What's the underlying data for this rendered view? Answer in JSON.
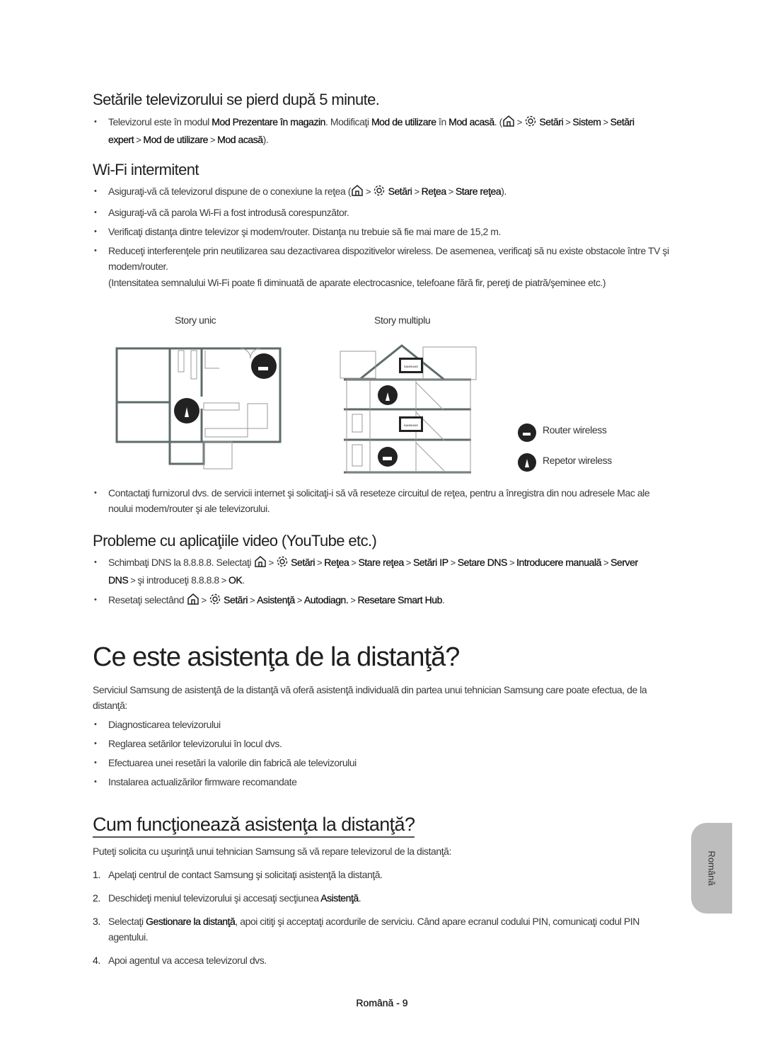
{
  "section1": {
    "title": "Setările televizorului se pierd după 5 minute.",
    "bullets": [
      [
        {
          "t": "Televizorul este în modul "
        },
        {
          "b": "Mod Prezentare în magazin"
        },
        {
          "t": ". Modificaţi "
        },
        {
          "b": "Mod de utilizare"
        },
        {
          "t": " în "
        },
        {
          "b": "Mod acasă"
        },
        {
          "t": ". ("
        },
        {
          "i": "home"
        },
        {
          "s": ">"
        },
        {
          "i": "gear"
        },
        {
          "b": " Setări"
        },
        {
          "s": ">"
        },
        {
          "b": "Sistem"
        },
        {
          "s": ">"
        },
        {
          "b": "Setări expert"
        },
        {
          "s": ">"
        },
        {
          "b": "Mod de utilizare"
        },
        {
          "s": ">"
        },
        {
          "b": "Mod acasă"
        },
        {
          "t": ")."
        }
      ]
    ]
  },
  "section2": {
    "title": "Wi-Fi intermitent",
    "bullets": [
      [
        {
          "t": "Asiguraţi-vă că televizorul dispune de o conexiune la reţea ("
        },
        {
          "i": "home"
        },
        {
          "s": ">"
        },
        {
          "i": "gear"
        },
        {
          "b": " Setări"
        },
        {
          "s": ">"
        },
        {
          "b": "Reţea"
        },
        {
          "s": ">"
        },
        {
          "b": "Stare reţea"
        },
        {
          "t": ")."
        }
      ],
      [
        {
          "t": "Asiguraţi-vă că parola Wi-Fi a fost introdusă corespunzător."
        }
      ],
      [
        {
          "t": "Verificaţi distanţa dintre televizor şi modem/router. Distanţa nu trebuie să fie mai mare de 15,2 m."
        }
      ],
      [
        {
          "t": "Reduceţi interferenţele prin neutilizarea sau dezactivarea dispozitivelor wireless. De asemenea, verificaţi să nu existe obstacole între TV şi modem/router."
        }
      ]
    ],
    "note": "(Intensitatea semnalului Wi-Fi poate fi diminuată de aparate electrocasnice, telefoane fără fir, pereţi de piatră/şeminee etc.)",
    "diagram": {
      "label_single": "Story unic",
      "label_multi": "Story multiplu",
      "legend_router": "Router wireless",
      "legend_repeater": "Repetor wireless",
      "tv_brand": "SAMSUNG"
    },
    "bullets_after": [
      [
        {
          "t": "Contactaţi furnizorul dvs. de servicii internet şi solicitaţi-i să vă reseteze circuitul de reţea, pentru a înregistra din nou adresele Mac ale noului modem/router şi ale televizorului."
        }
      ]
    ]
  },
  "section3": {
    "title": "Probleme cu aplicaţiile video (YouTube etc.)",
    "bullets": [
      [
        {
          "t": "Schimbaţi DNS la 8.8.8.8. Selectaţi "
        },
        {
          "i": "home"
        },
        {
          "s": ">"
        },
        {
          "i": "gear"
        },
        {
          "b": " Setări"
        },
        {
          "s": ">"
        },
        {
          "b": "Reţea"
        },
        {
          "s": ">"
        },
        {
          "b": "Stare reţea"
        },
        {
          "s": ">"
        },
        {
          "b": "Setări IP"
        },
        {
          "s": ">"
        },
        {
          "b": "Setare DNS"
        },
        {
          "s": ">"
        },
        {
          "b": "Introducere manuală"
        },
        {
          "s": ">"
        },
        {
          "b": "Server DNS"
        },
        {
          "s": ">"
        },
        {
          "t": "şi introduceţi 8.8.8.8"
        },
        {
          "s": ">"
        },
        {
          "b": "OK"
        },
        {
          "t": "."
        }
      ],
      [
        {
          "t": "Resetaţi selectând "
        },
        {
          "i": "home"
        },
        {
          "s": ">"
        },
        {
          "i": "gear"
        },
        {
          "b": " Setări"
        },
        {
          "s": ">"
        },
        {
          "b": "Asistenţă"
        },
        {
          "s": ">"
        },
        {
          "b": "Autodiagn."
        },
        {
          "s": ">"
        },
        {
          "b": "Resetare Smart Hub"
        },
        {
          "t": "."
        }
      ]
    ]
  },
  "section4": {
    "title": "Ce este asistenţa de la distanţă?",
    "intro": "Serviciul Samsung de asistenţă de la distanţă vă oferă asistenţă individuală din partea unui tehnician Samsung care poate efectua, de la distanţă:",
    "bullets": [
      [
        {
          "t": "Diagnosticarea televizorului"
        }
      ],
      [
        {
          "t": "Reglarea setărilor televizorului în locul dvs."
        }
      ],
      [
        {
          "t": "Efectuarea unei resetări la valorile din fabrică ale televizorului"
        }
      ],
      [
        {
          "t": "Instalarea actualizărilor firmware recomandate"
        }
      ]
    ]
  },
  "section5": {
    "title": "Cum funcţionează asistenţa la distanţă?",
    "intro": "Puteţi solicita cu uşurinţă unui tehnician Samsung să vă repare televizorul de la distanţă:",
    "steps": [
      [
        {
          "t": "Apelaţi centrul de contact Samsung şi solicitaţi asistenţă la distanţă."
        }
      ],
      [
        {
          "t": "Deschideţi meniul televizorului şi accesaţi secţiunea "
        },
        {
          "b": "Asistenţă"
        },
        {
          "t": "."
        }
      ],
      [
        {
          "t": "Selectaţi "
        },
        {
          "b": "Gestionare la distanţă"
        },
        {
          "t": ", apoi citiţi şi acceptaţi acordurile de serviciu. Când apare ecranul codului PIN, comunicaţi codul PIN agentului."
        }
      ],
      [
        {
          "t": "Apoi agentul va accesa televizorul dvs."
        }
      ]
    ],
    "step_numbers": [
      "1.",
      "2.",
      "3.",
      "4."
    ]
  },
  "side_tab": "Română",
  "footer": "Română - 9",
  "colors": {
    "text": "#3a3a3a",
    "heading": "#1f1f1f",
    "tab": "#bdbdbd",
    "plan": "#5f6b6b",
    "badge": "#222222"
  }
}
